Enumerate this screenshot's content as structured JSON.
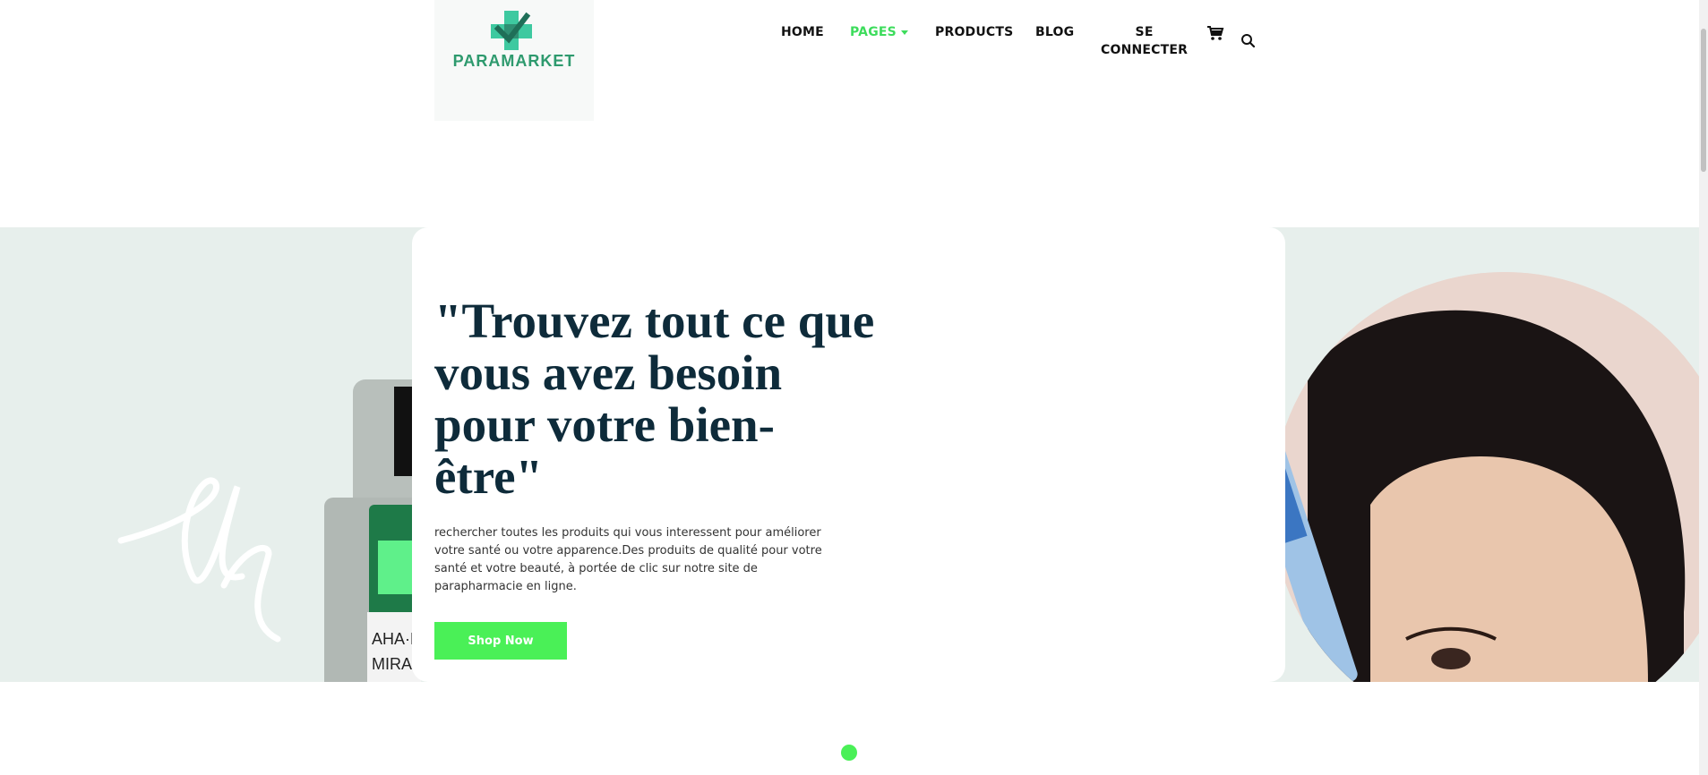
{
  "brand": {
    "name": "PARAMARKET",
    "logo_icon": "cross-check-icon"
  },
  "nav": {
    "home": "HOME",
    "pages": "PAGES",
    "products": "PRODUCTS",
    "blog": "BLOG",
    "login_line1": "SE",
    "login_line2": "CONNECTER",
    "cart_icon": "cart-icon",
    "search_icon": "search-icon"
  },
  "hero": {
    "headline": "\"Trouvez tout ce que vous avez besoin pour votre bien-être\"",
    "description": "rechercher toutes les produits qui vous interessent pour améliorer votre santé ou votre apparence.Des produits de qualité pour votre santé et votre beauté, à portée de clic sur notre site de parapharmacie en ligne.",
    "cta": "Shop Now",
    "product_label_1": "AHA·B",
    "product_label_2": "MIRAC"
  },
  "colors": {
    "accent": "#4af057",
    "brand_green": "#2e9a6e",
    "headline": "#0e2b3a",
    "hero_bg": "#e7efec"
  },
  "carousel": {
    "active_index": 1,
    "count": 1
  }
}
